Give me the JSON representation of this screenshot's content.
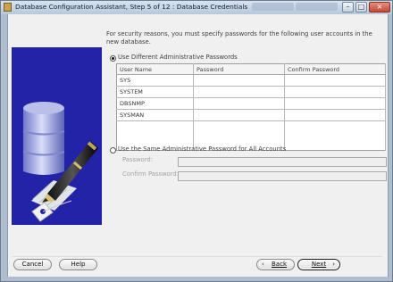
{
  "window": {
    "title": "Database Configuration Assistant, Step 5 of 12 : Database Credentials",
    "controls": {
      "minimize": "–",
      "maximize": "□",
      "close": "×"
    }
  },
  "instructions": "For security reasons, you must specify passwords for the following user accounts in the new database.",
  "password_mode": {
    "different": "Use Different Administrative Passwords",
    "same": "Use the Same Administrative Password for All Accounts"
  },
  "table": {
    "headers": [
      "User Name",
      "Password",
      "Confirm Password"
    ],
    "rows": [
      "SYS",
      "SYSTEM",
      "DBSNMP",
      "SYSMAN"
    ]
  },
  "shared_fields": {
    "password_label": "Password:",
    "confirm_label": "Confirm Password:"
  },
  "buttons": {
    "cancel": "Cancel",
    "help": "Help",
    "back": "Back",
    "next": "Next"
  },
  "colors": {
    "art_background": "#2323a8",
    "window_frame": "#aebdcf",
    "panel_background": "#f0f0f0"
  },
  "icons": {
    "title": "application-icon",
    "art": "database-pen-key-illustration",
    "back": "back-arrow-icon",
    "next": "next-arrow-icon"
  }
}
